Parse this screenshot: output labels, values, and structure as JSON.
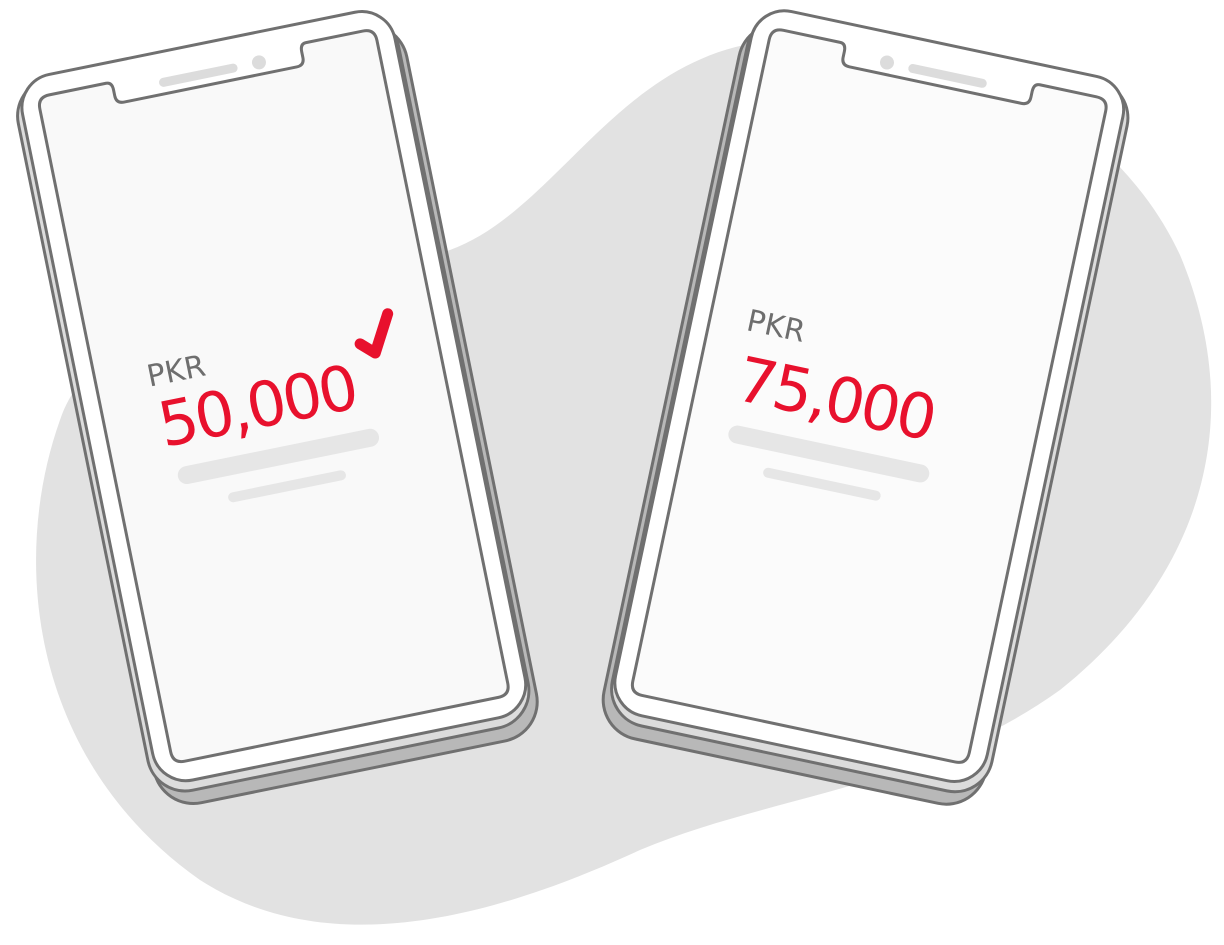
{
  "colors": {
    "accent": "#e8112d",
    "blob": "#e2e2e2",
    "outline": "#707070",
    "label": "#6e6e6e"
  },
  "phones": [
    {
      "currency": "PKR",
      "amount": "50,000",
      "icon": "checkmark-icon"
    },
    {
      "currency": "PKR",
      "amount": "75,000"
    }
  ]
}
